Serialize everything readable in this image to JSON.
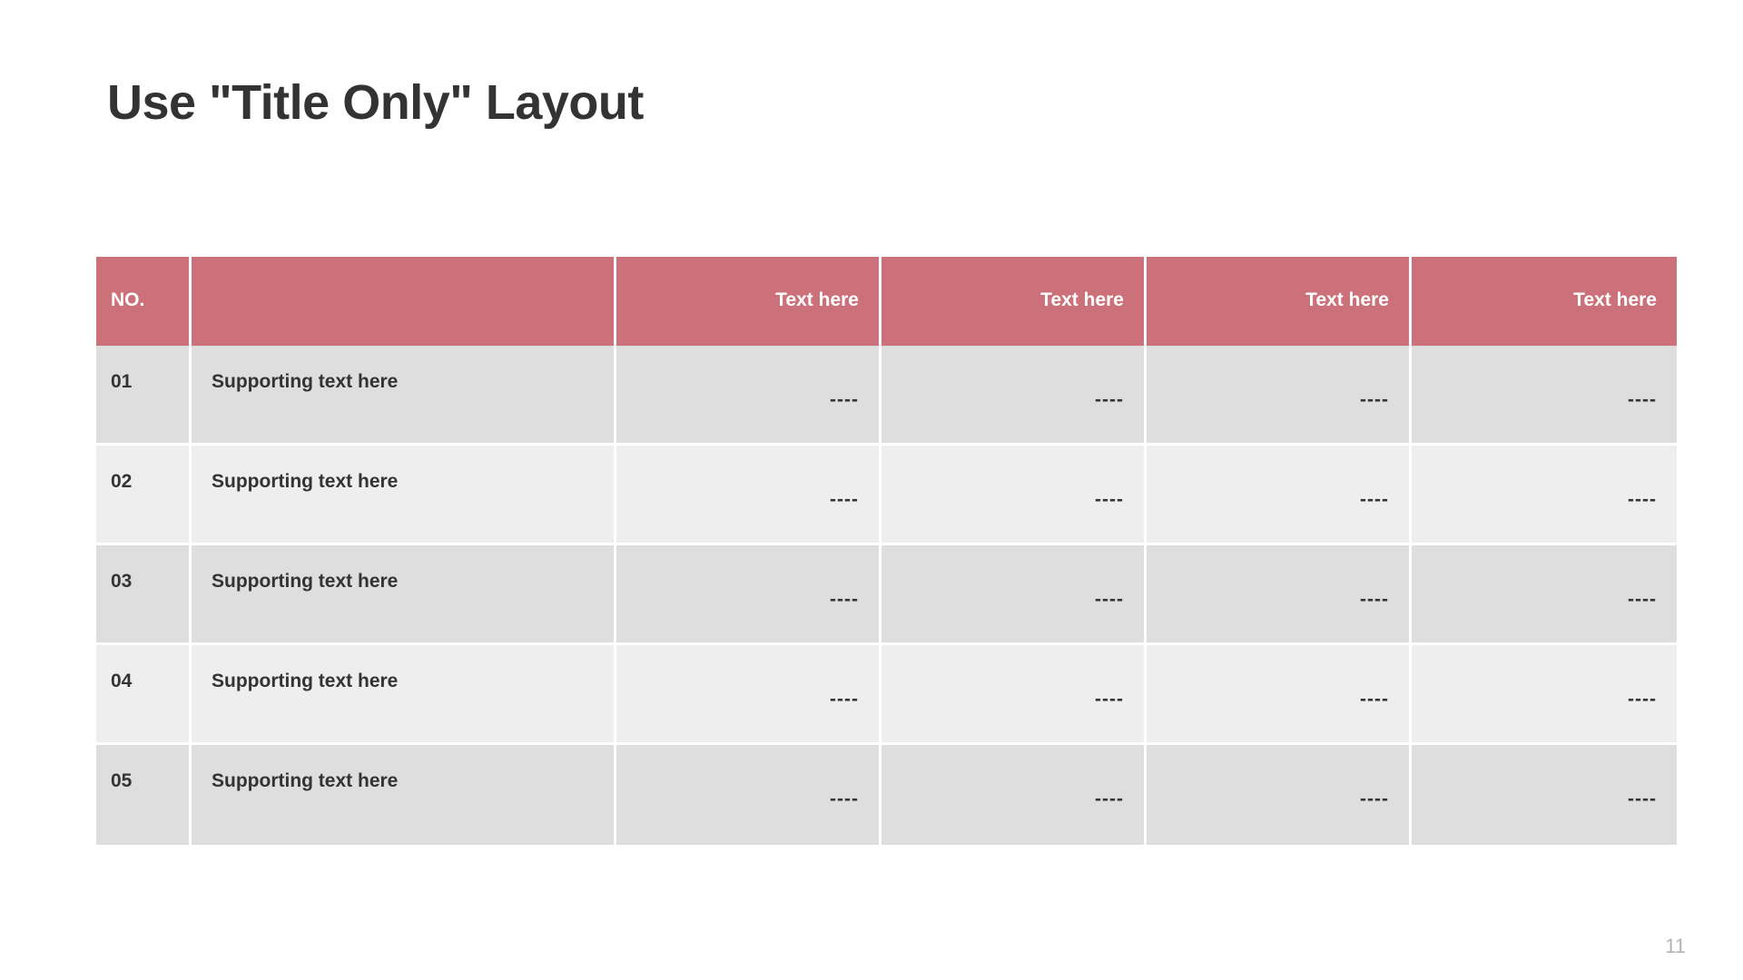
{
  "slide": {
    "title": "Use \"Title Only\" Layout",
    "page_number": "11",
    "accent_color": "#cc7179",
    "text_color": "#333333",
    "row_shade_dark": "#dedede",
    "row_shade_light": "#eeeeee",
    "page_number_color": "#b3b3b3"
  },
  "table": {
    "headers": [
      {
        "label": "NO.",
        "align": "left"
      },
      {
        "label": "",
        "align": "left"
      },
      {
        "label": "Text here",
        "align": "right"
      },
      {
        "label": "Text here",
        "align": "right"
      },
      {
        "label": "Text here",
        "align": "right"
      },
      {
        "label": "Text here",
        "align": "right"
      }
    ],
    "rows": [
      {
        "no": "01",
        "desc": "Supporting text here",
        "v1": "----",
        "v2": "----",
        "v3": "----",
        "v4": "----"
      },
      {
        "no": "02",
        "desc": "Supporting text here",
        "v1": "----",
        "v2": "----",
        "v3": "----",
        "v4": "----"
      },
      {
        "no": "03",
        "desc": "Supporting text here",
        "v1": "----",
        "v2": "----",
        "v3": "----",
        "v4": "----"
      },
      {
        "no": "04",
        "desc": "Supporting text here",
        "v1": "----",
        "v2": "----",
        "v3": "----",
        "v4": "----"
      },
      {
        "no": "05",
        "desc": "Supporting text here",
        "v1": "----",
        "v2": "----",
        "v3": "----",
        "v4": "----"
      }
    ]
  }
}
